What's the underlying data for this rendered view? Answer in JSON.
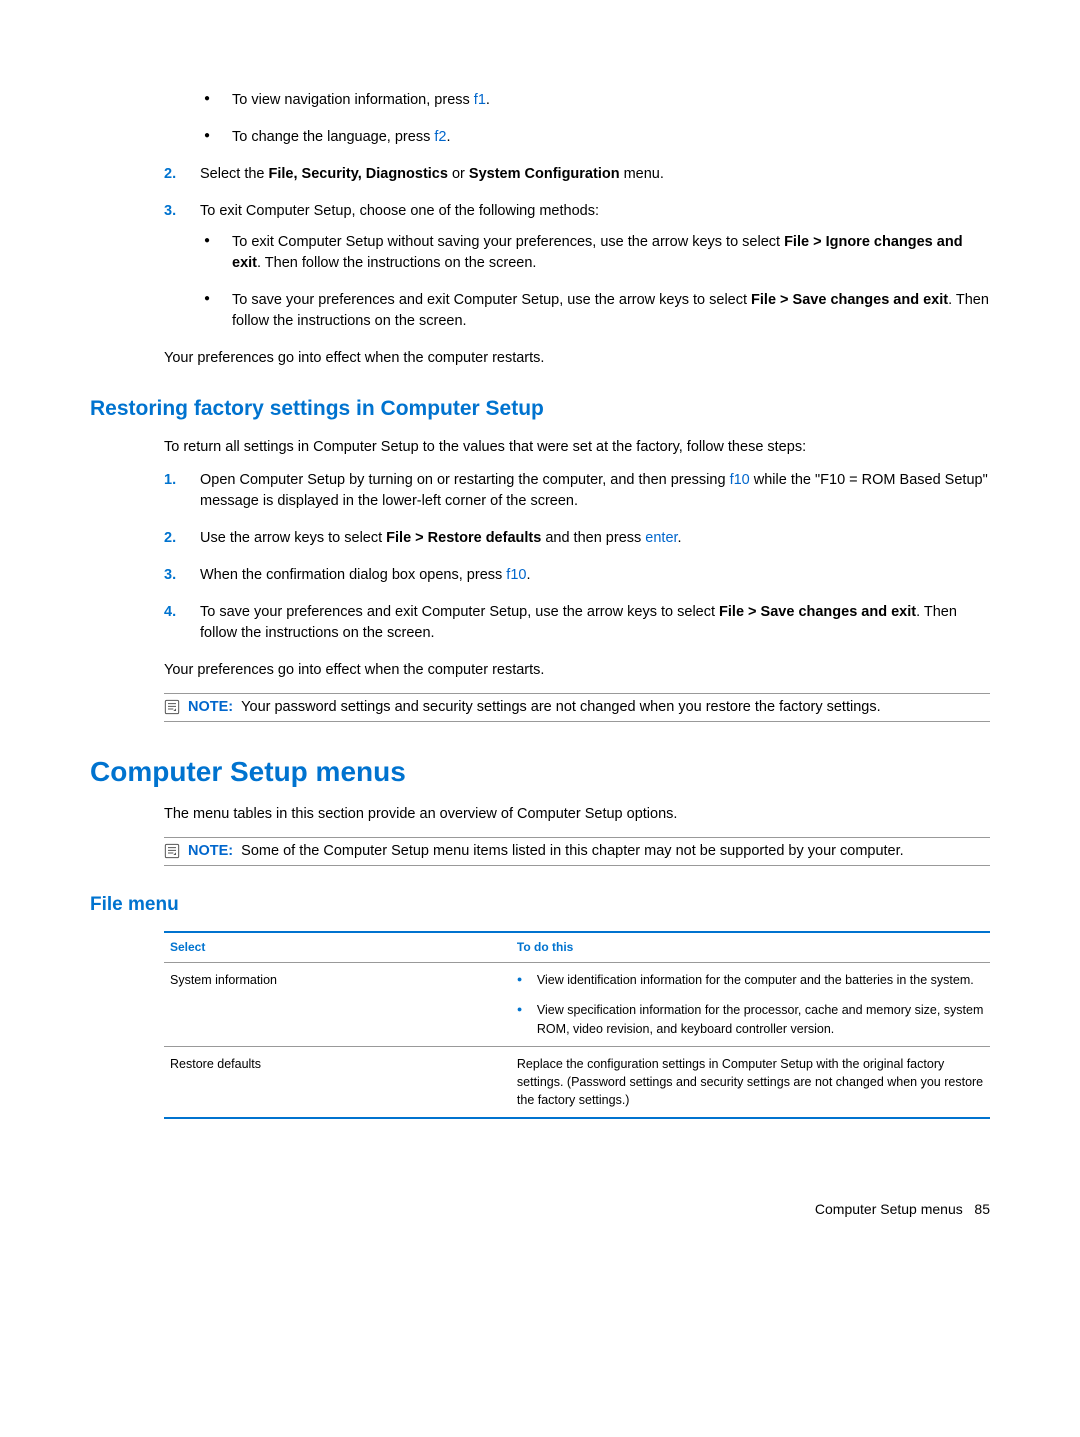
{
  "intro_bullets": [
    {
      "before": "To view navigation information, press ",
      "key": "f1",
      "after": "."
    },
    {
      "before": "To change the language, press ",
      "key": "f2",
      "after": "."
    }
  ],
  "step2": {
    "before": "Select the ",
    "bold": "File, Security, Diagnostics",
    "middle": " or ",
    "bold2": "System Configuration",
    "after": " menu."
  },
  "step3": {
    "intro": "To exit Computer Setup, choose one of the following methods:",
    "bullets": [
      {
        "text_before": "To exit Computer Setup without saving your preferences, use the arrow keys to select ",
        "bold": "File > Ignore changes and exit",
        "text_after": ". Then follow the instructions on the screen."
      },
      {
        "text_before": "To save your preferences and exit Computer Setup, use the arrow keys to select ",
        "bold": "File > Save changes and exit",
        "text_after": ". Then follow the instructions on the screen."
      }
    ]
  },
  "effect_para": "Your preferences go into effect when the computer restarts.",
  "restore_heading": "Restoring factory settings in Computer Setup",
  "restore_intro": "To return all settings in Computer Setup to the values that were set at the factory, follow these steps:",
  "restore_steps": {
    "s1_before": "Open Computer Setup by turning on or restarting the computer, and then pressing ",
    "s1_key": "f10",
    "s1_after": " while the \"F10 = ROM Based Setup\" message is displayed in the lower-left corner of the screen.",
    "s2_before": "Use the arrow keys to select ",
    "s2_bold": "File > Restore defaults",
    "s2_mid": " and then press ",
    "s2_key": "enter",
    "s2_after": ".",
    "s3_before": "When the confirmation dialog box opens, press ",
    "s3_key": "f10",
    "s3_after": ".",
    "s4_before": "To save your preferences and exit Computer Setup, use the arrow keys to select ",
    "s4_bold": "File > Save changes and exit",
    "s4_after": ". Then follow the instructions on the screen."
  },
  "note1_label": "NOTE:",
  "note1_text": "Your password settings and security settings are not changed when you restore the factory settings.",
  "menus_heading": "Computer Setup menus",
  "menus_intro": "The menu tables in this section provide an overview of Computer Setup options.",
  "note2_label": "NOTE:",
  "note2_text": "Some of the Computer Setup menu items listed in this chapter may not be supported by your computer.",
  "file_menu_heading": "File menu",
  "table": {
    "head_select": "Select",
    "head_todo": "To do this",
    "rows": [
      {
        "select": "System information",
        "bullets": [
          "View identification information for the computer and the batteries in the system.",
          "View specification information for the processor, cache and memory size, system ROM, video revision, and keyboard controller version."
        ],
        "plain": null
      },
      {
        "select": "Restore defaults",
        "bullets": null,
        "plain": "Replace the configuration settings in Computer Setup with the original factory settings. (Password settings and security settings are not changed when you restore the factory settings.)"
      }
    ]
  },
  "footer_label": "Computer Setup menus",
  "footer_page": "85"
}
